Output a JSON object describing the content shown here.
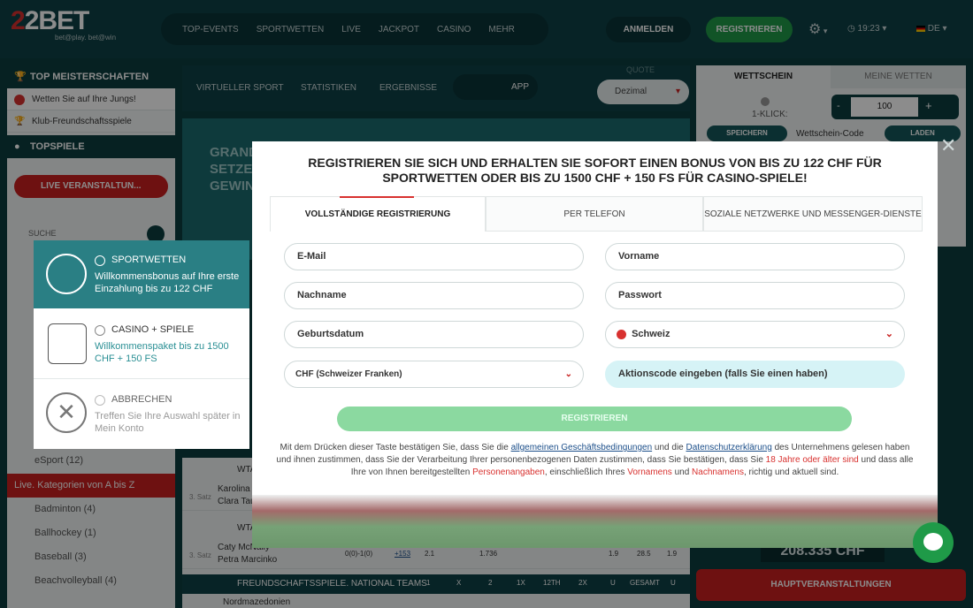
{
  "header": {
    "logo_main": "22BET",
    "logo_tagline": "bet@play. bet@win",
    "nav": [
      "TOP-EVENTS",
      "SPORTWETTEN",
      "LIVE",
      "JACKPOT",
      "CASINO",
      "MEHR"
    ],
    "login": "ANMELDEN",
    "register": "REGISTRIEREN",
    "time": "19:23",
    "lang": "DE"
  },
  "sidebar": {
    "top_meisterschaften": "TOP MEISTERSCHAFTEN",
    "items": [
      "Wetten Sie auf Ihre Jungs!",
      "Klub-Freundschaftsspiele"
    ],
    "topspiele": "TOPSPIELE",
    "live_button": "LIVE VERANSTALTUN...",
    "search_placeholder": "SUCHE",
    "esport": "eSport (12)",
    "categories_header": "Live. Kategorien von A bis Z",
    "sports": [
      "Badminton (4)",
      "Ballhockey (1)",
      "Baseball (3)",
      "Beachvolleyball (4)"
    ]
  },
  "subnav": {
    "items": [
      "VIRTUELLER SPORT",
      "STATISTIKEN",
      "ERGEBNISSE"
    ],
    "app": "APP",
    "quote_label": "QUOTE",
    "quote_value": "Dezimal"
  },
  "banner_text": [
    "GRAND",
    "SETZE A",
    "GEWINN"
  ],
  "betslip": {
    "tab1": "WETTSCHEIN",
    "tab2": "MEINE WETTEN",
    "one_click": "1-KLICK:",
    "stake": "100",
    "save": "SPEICHERN",
    "code": "Wettschein-Code",
    "load": "LADEN"
  },
  "matches": {
    "row1": [
      "WTA",
      "Karolina",
      "Clara Tau",
      "3. Satz"
    ],
    "row2": [
      "WTA",
      "Caty McNally",
      "Petra Marcinko",
      "3. Satz",
      "0(0)-1(0)",
      "+153",
      "2.1",
      "1.736",
      "1.9",
      "28.5",
      "1.9"
    ],
    "row3_title": "FREUNDSCHAFTSSPIELE. NATIONAL TEAMS",
    "row3_cols": [
      "1",
      "X",
      "2",
      "1X",
      "12TH",
      "2X",
      "U",
      "GESAMT",
      "U"
    ],
    "row3_team": "Nordmazedonien"
  },
  "promo_amount": "208.335 CHF",
  "hauptveranstaltungen": "HAUPTVERANSTALTUNGEN",
  "bonus_choice": {
    "sport_title": "SPORTWETTEN",
    "sport_desc": "Willkommensbonus auf Ihre erste Einzahlung bis zu 122 CHF",
    "casino_title": "CASINO + SPIELE",
    "casino_desc": "Willkommenspaket bis zu 1500 CHF + 150 FS",
    "cancel_title": "ABBRECHEN",
    "cancel_desc": "Treffen Sie Ihre Auswahl später in Mein Konto"
  },
  "modal": {
    "title": "REGISTRIEREN SIE SICH UND ERHALTEN SIE SOFORT EINEN BONUS VON BIS ZU 122 CHF FÜR SPORTWETTEN ODER BIS ZU 1500 CHF + 150 FS FÜR CASINO-SPIELE!",
    "tabs": [
      "VOLLSTÄNDIGE REGISTRIERUNG",
      "PER TELEFON",
      "SOZIALE NETZWERKE UND MESSENGER-DIENSTE"
    ],
    "fields": {
      "email": "E-Mail",
      "first_name": "Vorname",
      "last_name": "Nachname",
      "password": "Passwort",
      "birthdate": "Geburtsdatum",
      "country": "Schweiz",
      "currency": "CHF (Schweizer Franken)",
      "promo": "Aktionscode eingeben (falls Sie einen haben)"
    },
    "submit": "REGISTRIEREN",
    "terms": {
      "t1": "Mit dem Drücken dieser Taste bestätigen Sie, dass Sie die ",
      "l1": "allgemeinen Geschäftsbedingungen",
      "t2": " und die ",
      "l2": "Datenschutzerklärung",
      "t3": " des Unternehmens gelesen haben und ihnen zustimmen, dass Sie der Verarbeitung Ihrer personenbezogenen Daten zustimmen, dass Sie bestätigen, dass Sie ",
      "r1": "18 Jahre oder älter sind",
      "t4": " und dass alle Ihre von Ihnen bereitgestellten ",
      "r2": "Personenangaben",
      "t5": ", einschließlich Ihres ",
      "r3": "Vornamens",
      "t6": " und ",
      "r4": "Nachnamens",
      "t7": ", richtig und aktuell sind."
    }
  }
}
